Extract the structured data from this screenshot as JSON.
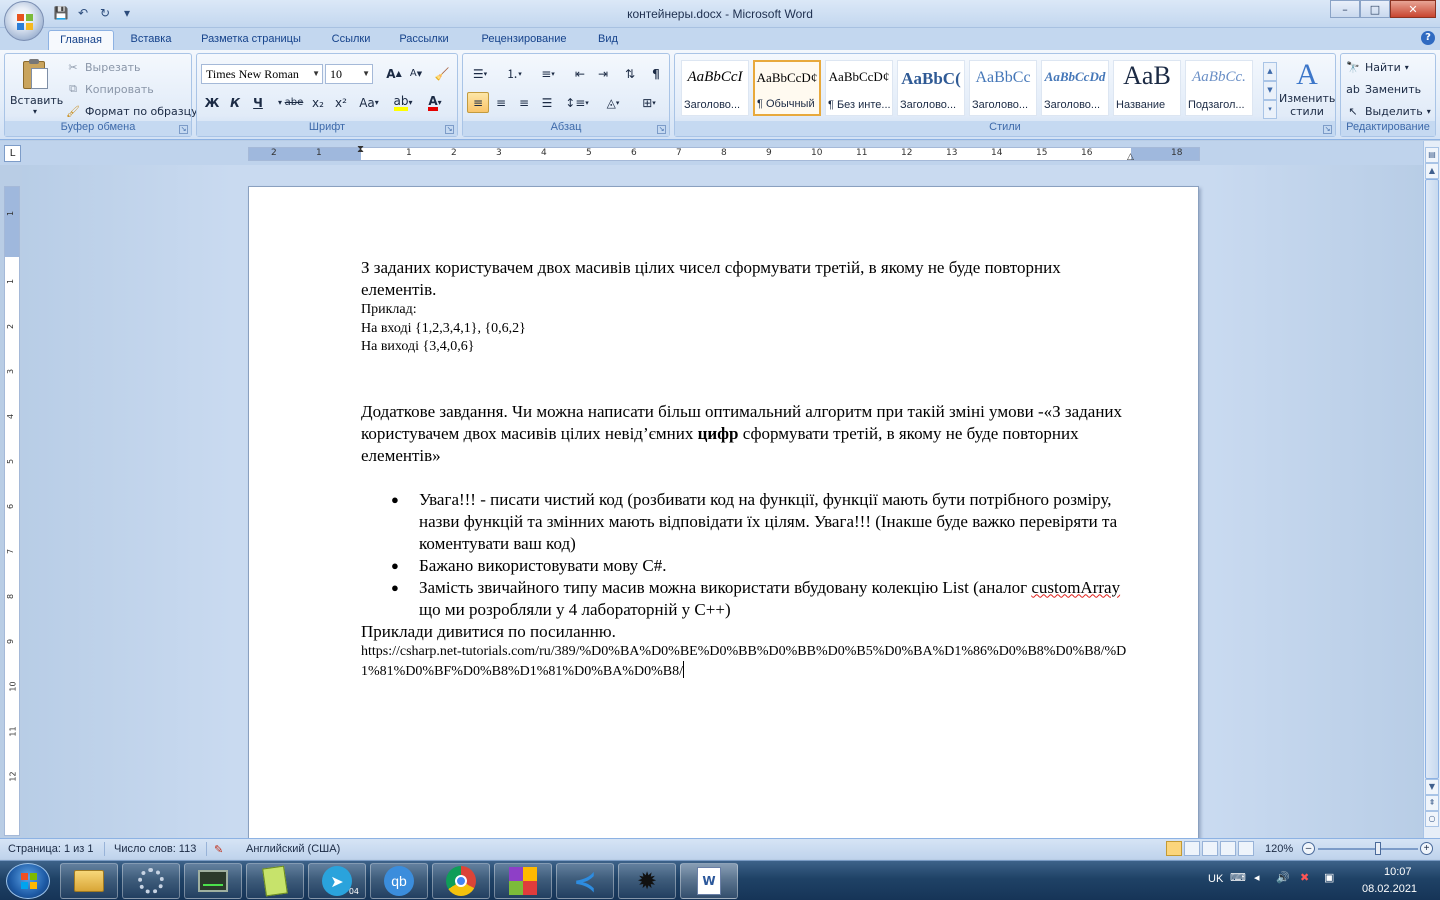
{
  "window": {
    "title": "контейнеры.docx - Microsoft Word",
    "controls": {
      "minimize": "–",
      "maximize": "□",
      "close": "✕"
    }
  },
  "tabs": [
    "Главная",
    "Вставка",
    "Разметка страницы",
    "Ссылки",
    "Рассылки",
    "Рецензирование",
    "Вид"
  ],
  "ribbon": {
    "clipboard": {
      "label": "Буфер обмена",
      "paste": "Вставить",
      "cut": "Вырезать",
      "copy": "Копировать",
      "format_painter": "Формат по образцу"
    },
    "font": {
      "label": "Шрифт",
      "name": "Times New Roman",
      "size": "10",
      "bold": "Ж",
      "italic": "К",
      "underline": "Ч",
      "strike": "abe",
      "subscript": "x₂",
      "superscript": "x²",
      "case": "Aa",
      "grow": "A",
      "shrink": "A"
    },
    "paragraph": {
      "label": "Абзац",
      "pilcrow": "¶"
    },
    "styles": {
      "label": "Стили",
      "items": [
        {
          "sample": "AaBbCcI",
          "name": "Заголово..."
        },
        {
          "sample": "AaBbCcD¢",
          "name": "¶ Обычный"
        },
        {
          "sample": "AaBbCcD¢",
          "name": "¶ Без инте..."
        },
        {
          "sample": "AaBbC(",
          "name": "Заголово..."
        },
        {
          "sample": "AaBbCc",
          "name": "Заголово..."
        },
        {
          "sample": "AaBbCcDd",
          "name": "Заголово..."
        },
        {
          "sample": "AaB",
          "name": "Название"
        },
        {
          "sample": "AaBbCc.",
          "name": "Подзагол..."
        }
      ],
      "change": "Изменить стили"
    },
    "editing": {
      "label": "Редактирование",
      "find": "Найти",
      "replace": "Заменить",
      "select": "Выделить"
    }
  },
  "ruler": {
    "h_numbers": [
      "2",
      "1",
      "1",
      "2",
      "3",
      "4",
      "5",
      "6",
      "7",
      "8",
      "9",
      "10",
      "11",
      "12",
      "13",
      "14",
      "15",
      "16",
      "18"
    ],
    "v_numbers": [
      "1",
      "1",
      "2",
      "3",
      "4",
      "5",
      "6",
      "7",
      "8",
      "9",
      "10",
      "11",
      "12"
    ]
  },
  "document": {
    "p1": "З заданих користувачем двох масивів цілих чисел сформувати третій, в якому не буде повторних елементів.",
    "example_label": "Приклад:",
    "input_line": "На вході {1,2,3,4,1}, {0,6,2}",
    "output_line": "На виході {3,4,0,6}",
    "extra_1": "Додаткове завдання. Чи можна написати більш оптимальний алгоритм при такій зміні умови ",
    "extra_2": "-«З заданих користувачем двох масивів цілих невід’ємних ",
    "extra_bold": "цифр",
    "extra_3": " сформувати третій, в якому не буде повторних елементів»",
    "bullet1": "Увага!!! -  писати чистий код (розбивати код на функції, функції мають бути потрібного розміру,  назви функцій та змінних мають відповідати їх цілям. Увага!!! (Інакше буде важко перевіряти та коментувати ваш код)",
    "bullet2": "Бажано використовувати мову C#.",
    "bullet3_a": "Замість звичайного типу  масив можна використати вбудовану колекцію List (аналог ",
    "bullet3_squig": "customArray",
    "bullet3_b": " що ми розробляли у 4 лабораторній у C++)",
    "links_intro": "Приклади дивитися по посиланню.",
    "url": "https://csharp.net-tutorials.com/ru/389/%D0%BA%D0%BE%D0%BB%D0%BB%D0%B5%D0%BA%D1%86%D0%B8%D0%B8/%D1%81%D0%BF%D0%B8%D1%81%D0%BA%D0%B8/",
    "bullet_char": "●"
  },
  "status": {
    "page": "Страница: 1 из 1",
    "words": "Число слов: 113",
    "language": "Английский (США)",
    "zoom": "120%",
    "zoom_level": 0.6
  },
  "taskbar": {
    "apps": [
      "file-explorer",
      "control-panel",
      "task-manager",
      "notepad-plus",
      "telegram",
      "qbittorrent",
      "chrome",
      "winrar",
      "vscode",
      "bug-app",
      "word"
    ],
    "telegram_badge": "04",
    "qb_label": "qb",
    "lang": "UK",
    "time": "10:07",
    "date": "08.02.2021"
  }
}
